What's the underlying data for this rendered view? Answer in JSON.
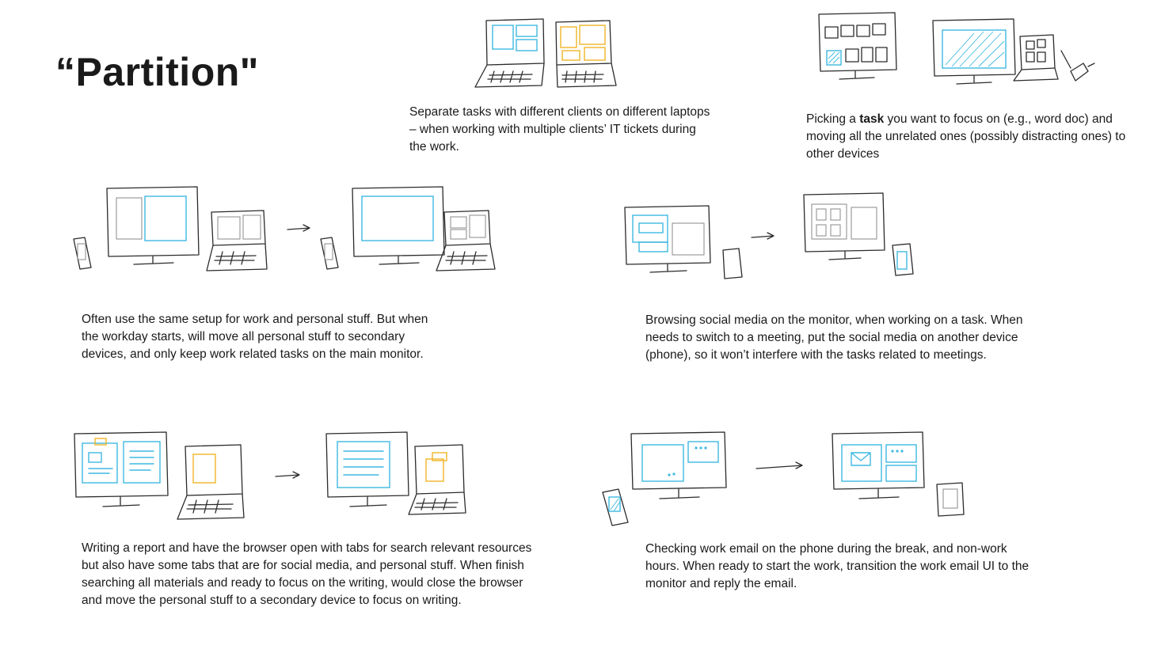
{
  "title": "“Partition\"",
  "scenarios": {
    "laptops": {
      "text": "Separate tasks with different clients on different laptops – when working with multiple clients’ IT tickets during the work."
    },
    "focus": {
      "text_before": "Picking a ",
      "text_bold": "task",
      "text_after": " you want to focus on (e.g., word doc) and moving all the unrelated ones (possibly distracting ones) to other devices"
    },
    "work_personal": {
      "text": "Often use the same setup for work and personal stuff. But when the workday starts, will move all personal stuff to secondary devices, and only keep work related tasks on the main monitor."
    },
    "social_media": {
      "text": "Browsing social media on the monitor, when working on a task. When needs to switch to a meeting, put the social media on another device (phone), so it won’t interfere with the tasks related to meetings."
    },
    "report": {
      "text": "Writing a report and have the browser open with tabs for search relevant resources but also have some tabs that are for social media, and personal stuff. When finish searching all materials and ready to focus on the writing, would close the browser and move the personal stuff to a secondary device to focus on writing."
    },
    "email": {
      "text": "Checking work email on the phone during the break, and non-work hours. When ready to start the work, transition the work email UI to the monitor and reply the email."
    }
  },
  "colors": {
    "sketch_line": "#2b2b2b",
    "accent_blue": "#3fb8e2",
    "accent_yellow": "#f1b529",
    "text": "#1a1a1a"
  }
}
